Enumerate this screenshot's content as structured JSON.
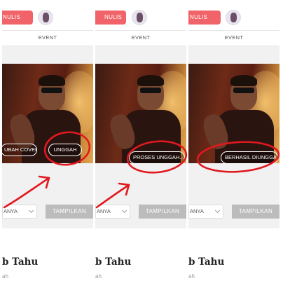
{
  "panels": [
    {
      "menulis_label": "NULIS",
      "event_label": "EVENT",
      "cover_buttons": {
        "change_cover": "UBAH COVER",
        "upload": "UNGGAH"
      },
      "filter": {
        "select_value": "ANYA",
        "submit": "TAMPILKAN"
      },
      "card": {
        "title": "b Tahu",
        "subtitle": "ah"
      }
    },
    {
      "menulis_label": "NULIS",
      "event_label": "EVENT",
      "status": "PROSES UNGGAH...",
      "filter": {
        "select_value": "ANYA",
        "submit": "TAMPILKAN"
      },
      "card": {
        "title": "b Tahu",
        "subtitle": "ah"
      }
    },
    {
      "menulis_label": "NULIS",
      "event_label": "EVENT",
      "status": "BERHASIL DIUNGGAH",
      "filter": {
        "select_value": "ANYA",
        "submit": "TAMPILKAN"
      },
      "card": {
        "title": "b Tahu",
        "subtitle": "ah"
      }
    }
  ],
  "colors": {
    "accent": "#f06469",
    "annotation": "#e0191f",
    "button_gray": "#bcbcbc"
  },
  "icons": [
    "avatar",
    "chevron-down-icon",
    "arrow-annotation"
  ]
}
